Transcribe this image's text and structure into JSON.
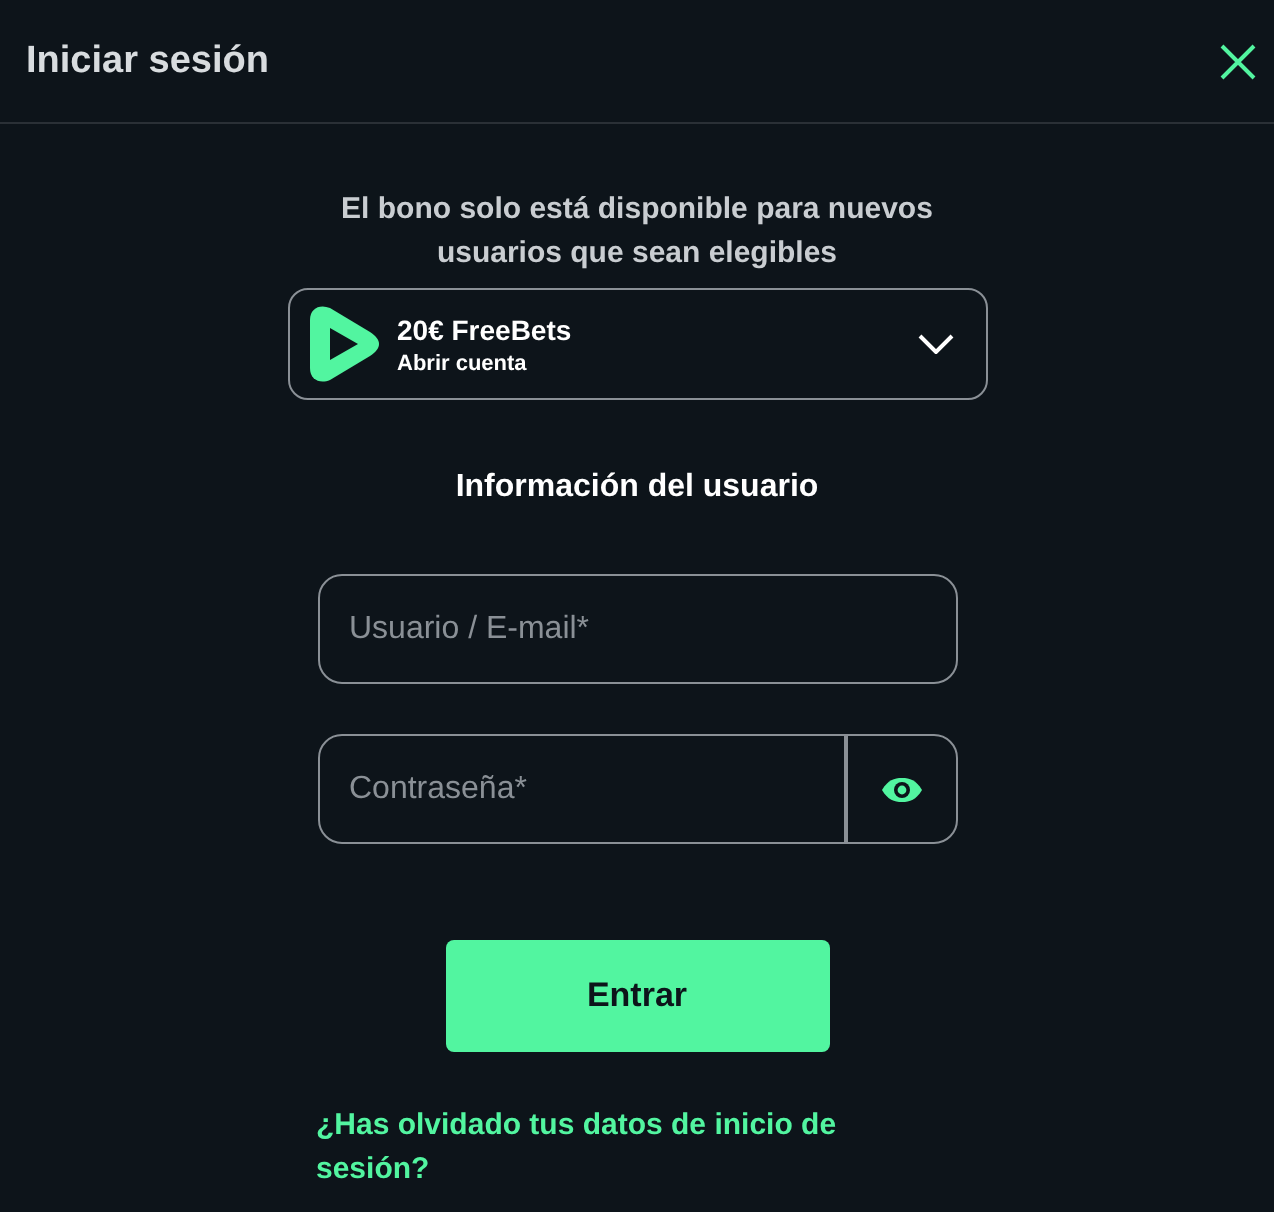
{
  "header": {
    "title": "Iniciar sesión"
  },
  "bonus": {
    "notice": "El bono solo está disponible para nuevos usuarios que sean elegibles",
    "title": "20€ FreeBets",
    "subtitle": "Abrir cuenta",
    "expanded": false
  },
  "form": {
    "heading": "Información del usuario",
    "username": {
      "placeholder": "Usuario / E-mail*"
    },
    "password": {
      "placeholder": "Contraseña*"
    },
    "submit": "Entrar",
    "forgot_link": "¿Has olvidado tus datos de inicio de sesión?"
  }
}
